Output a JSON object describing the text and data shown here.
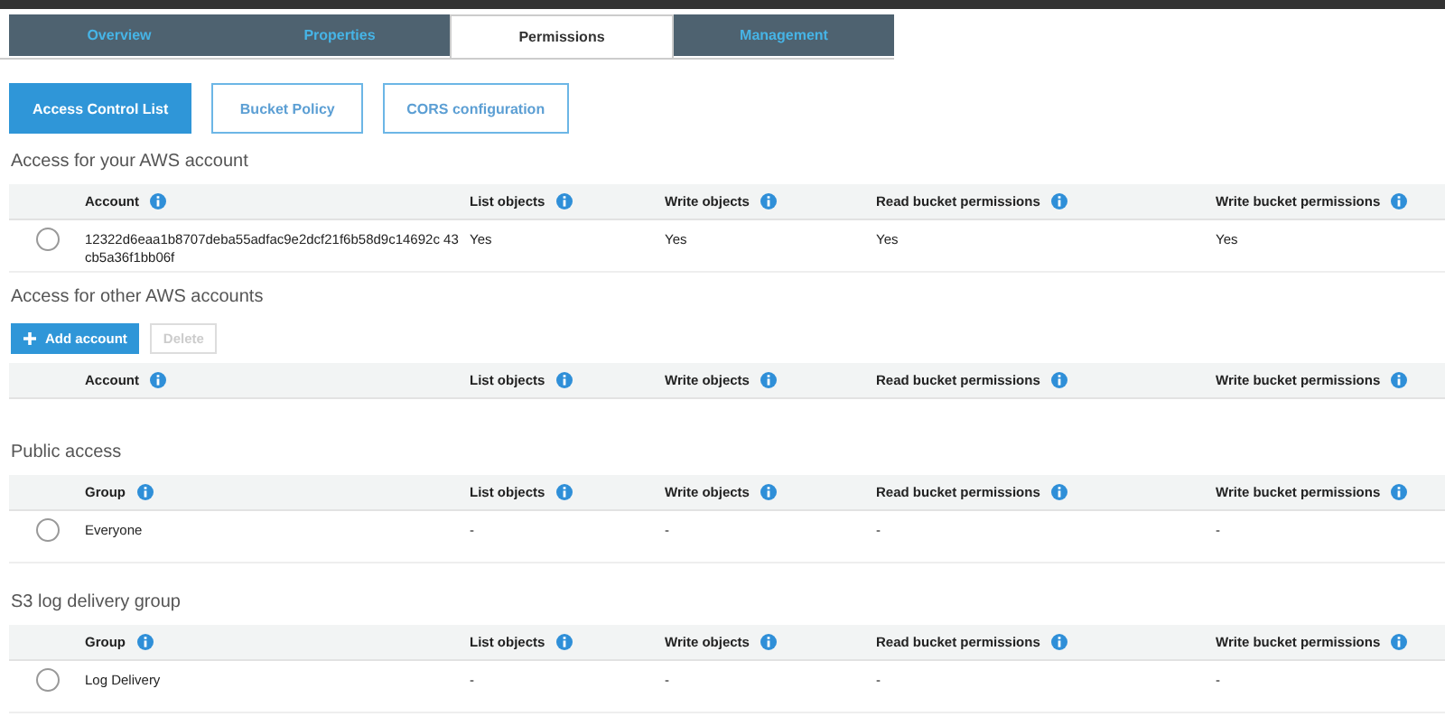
{
  "tabs": [
    {
      "label": "Overview",
      "selected": false
    },
    {
      "label": "Properties",
      "selected": false
    },
    {
      "label": "Permissions",
      "selected": true
    },
    {
      "label": "Management",
      "selected": false
    }
  ],
  "subtabs": [
    {
      "label": "Access Control List",
      "selected": true
    },
    {
      "label": "Bucket Policy",
      "selected": false
    },
    {
      "label": "CORS configuration",
      "selected": false
    }
  ],
  "sections": [
    {
      "title": "Access for your AWS account",
      "columns": [
        "Account",
        "List objects",
        "Write objects",
        "Read bucket permissions",
        "Write bucket permissions"
      ],
      "rows": [
        {
          "selected": false,
          "cells": [
            "12322d6eaa1b8707deba55adfac9e2dcf21f6b58d9c14692c 43cb5a36f1bb06f",
            "Yes",
            "Yes",
            "Yes",
            "Yes"
          ]
        }
      ]
    },
    {
      "title": "Access for other AWS accounts",
      "buttons": [
        {
          "label": "Add account",
          "kind": "add",
          "disabled": false
        },
        {
          "label": "Delete",
          "kind": "plain",
          "disabled": true
        }
      ],
      "columns": [
        "Account",
        "List objects",
        "Write objects",
        "Read bucket permissions",
        "Write bucket permissions"
      ]
    },
    {
      "title": "Public access",
      "columns": [
        "Group",
        "List objects",
        "Write objects",
        "Read bucket permissions",
        "Write bucket permissions"
      ],
      "rows": [
        {
          "selected": false,
          "cells": [
            "Everyone",
            "-",
            "-",
            "-",
            "-"
          ]
        }
      ]
    },
    {
      "title": "S3 log delivery group",
      "columns": [
        "Group",
        "List objects",
        "Write objects",
        "Read bucket permissions",
        "Write bucket permissions"
      ],
      "rows": [
        {
          "selected": false,
          "cells": [
            "Log Delivery",
            "-",
            "-",
            "-",
            "-"
          ]
        }
      ]
    }
  ]
}
